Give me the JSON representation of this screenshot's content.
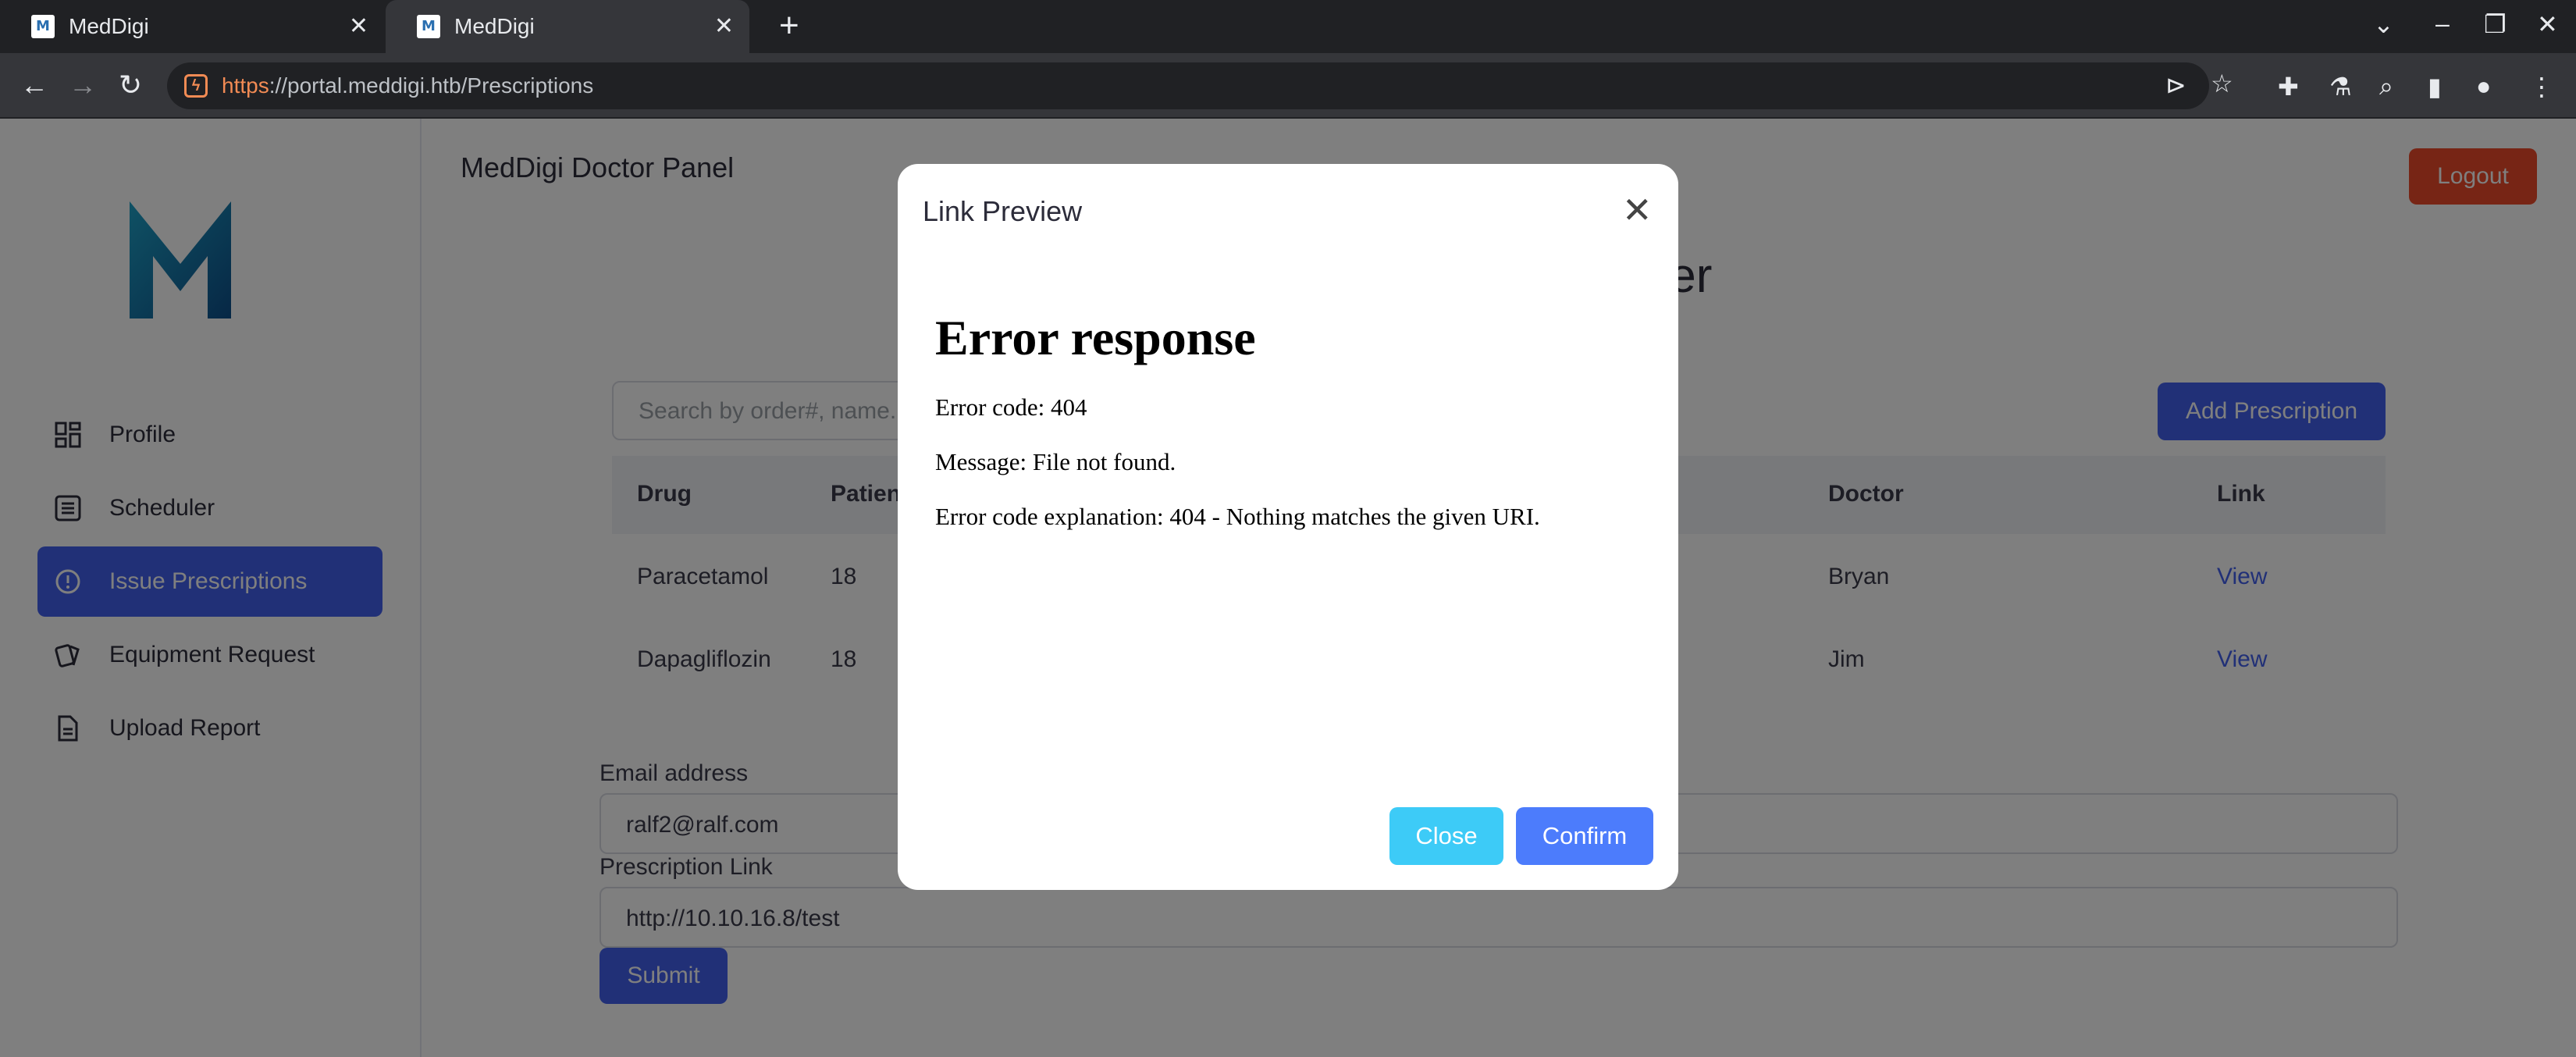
{
  "browser": {
    "tabs": [
      {
        "title": "MedDigi",
        "active": false
      },
      {
        "title": "MedDigi",
        "active": true
      }
    ],
    "url_scheme": "https",
    "url_rest": "://portal.meddigi.htb/Prescriptions"
  },
  "header": {
    "title": "MedDigi Doctor Panel",
    "logout_label": "Logout",
    "page_heading_visible": "uler"
  },
  "sidebar": {
    "items": [
      {
        "label": "Profile",
        "icon": "dashboard-icon",
        "active": false
      },
      {
        "label": "Scheduler",
        "icon": "list-icon",
        "active": false
      },
      {
        "label": "Issue Prescriptions",
        "icon": "alert-circle-icon",
        "active": true
      },
      {
        "label": "Equipment Request",
        "icon": "cards-icon",
        "active": false
      },
      {
        "label": "Upload Report",
        "icon": "document-icon",
        "active": false
      }
    ]
  },
  "prescriptions": {
    "search_placeholder": "Search by order#, name...",
    "add_label": "Add Prescription",
    "columns": [
      "Drug",
      "Patien",
      "Doctor",
      "Link"
    ],
    "rows": [
      {
        "drug": "Paracetamol",
        "patient": "18",
        "doctor": "Bryan",
        "link": "View"
      },
      {
        "drug": "Dapagliflozin",
        "patient": "18",
        "doctor": "Jim",
        "link": "View"
      }
    ]
  },
  "form": {
    "email_label": "Email address",
    "email_value": "ralf2@ralf.com",
    "link_label": "Prescription Link",
    "link_value": "http://10.10.16.8/test",
    "submit_label": "Submit"
  },
  "modal": {
    "title": "Link Preview",
    "error_heading": "Error response",
    "error_code": "Error code: 404",
    "message": "Message: File not found.",
    "explanation": "Error code explanation: 404 - Nothing matches the given URI.",
    "close_label": "Close",
    "confirm_label": "Confirm"
  },
  "colors": {
    "primary": "#4361ee",
    "logout": "#ef4b2a",
    "close_button": "#3dcbf7",
    "confirm_button": "#4c7cfc"
  }
}
